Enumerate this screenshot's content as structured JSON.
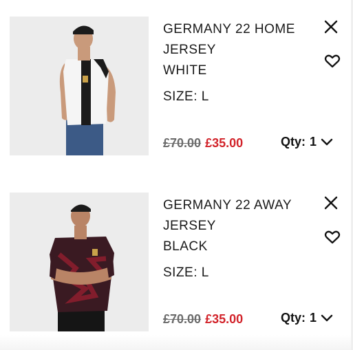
{
  "cart": {
    "items": [
      {
        "name_lines": [
          "GERMANY 22 HOME",
          "JERSEY",
          "WHITE"
        ],
        "size_label": "SIZE:",
        "size_value": "L",
        "old_price": "£70.00",
        "new_price": "£35.00",
        "qty_label": "Qty:",
        "qty_value": "1",
        "image": "model-wearing-white-home-jersey"
      },
      {
        "name_lines": [
          "GERMANY 22 AWAY",
          "JERSEY",
          "BLACK"
        ],
        "size_label": "SIZE:",
        "size_value": "L",
        "old_price": "£70.00",
        "new_price": "£35.00",
        "qty_label": "Qty:",
        "qty_value": "1",
        "image": "model-wearing-black-away-jersey"
      }
    ]
  },
  "icons": {
    "remove": "close-icon",
    "wishlist": "heart-icon",
    "qty_dropdown": "chevron-down-icon"
  },
  "colors": {
    "sale_price": "#d2232a",
    "old_price": "#6b6b6b",
    "text": "#1a1a1a",
    "image_bg": "#ededed"
  }
}
